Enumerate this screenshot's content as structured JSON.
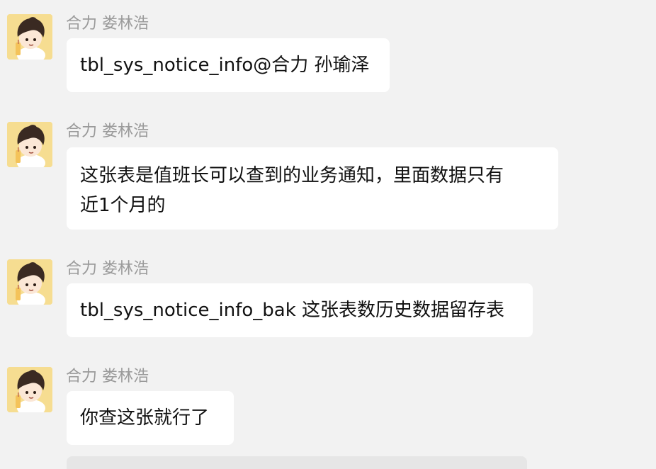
{
  "messages": [
    {
      "sender": "合力 娄林浩",
      "text": "tbl_sys_notice_info@合力 孙瑜泽"
    },
    {
      "sender": "合力 娄林浩",
      "line1": "这张表是值班长可以查到的业务通知，里面数据只有",
      "line2": "近1个月的"
    },
    {
      "sender": "合力 娄林浩",
      "text": "tbl_sys_notice_info_bak 这张表数历史数据留存表"
    },
    {
      "sender": "合力 娄林浩",
      "text": "你查这张就行了"
    }
  ],
  "colors": {
    "background": "#f2f2f2",
    "bubble": "#ffffff",
    "sender_name": "#9a9a9a",
    "text": "#111111",
    "avatar_bg": "#f6dd91"
  },
  "avatar": {
    "icon": "cartoon-avatar-icon"
  }
}
